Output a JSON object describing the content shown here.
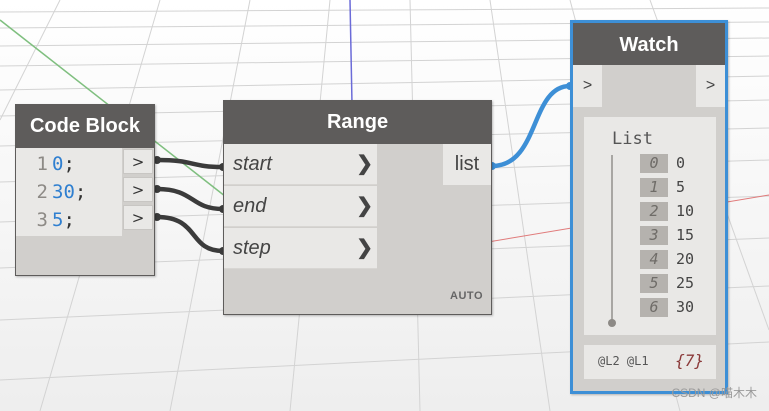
{
  "colors": {
    "node_header": "#5e5c5b",
    "node_body": "#d1cfcc",
    "port": "#e9e8e6",
    "wire": "#3b3b3b",
    "selected_wire": "#3d8fd6",
    "selection_border": "#3d8fd6",
    "code_number": "#2f7fd0",
    "count_text": "#8b3a3a"
  },
  "code_block": {
    "title": "Code Block",
    "lines": [
      {
        "num": "1",
        "code": "0",
        "semi": ";"
      },
      {
        "num": "2",
        "code": "30",
        "semi": ";"
      },
      {
        "num": "3",
        "code": "5",
        "semi": ";"
      }
    ],
    "output_arrows": [
      ">",
      ">",
      ">"
    ]
  },
  "range_node": {
    "title": "Range",
    "inputs": [
      "start",
      "end",
      "step"
    ],
    "input_arrow": "❯",
    "output": "list",
    "lacing": "AUTO"
  },
  "watch_node": {
    "title": "Watch",
    "in_arrow": ">",
    "out_arrow": ">",
    "list_label": "List",
    "items": [
      {
        "index": "0",
        "value": "0"
      },
      {
        "index": "1",
        "value": "5"
      },
      {
        "index": "2",
        "value": "10"
      },
      {
        "index": "3",
        "value": "15"
      },
      {
        "index": "4",
        "value": "20"
      },
      {
        "index": "5",
        "value": "25"
      },
      {
        "index": "6",
        "value": "30"
      }
    ],
    "levels": "@L2 @L1",
    "count": "{7}"
  },
  "watermark": "CSDN @喵木木"
}
